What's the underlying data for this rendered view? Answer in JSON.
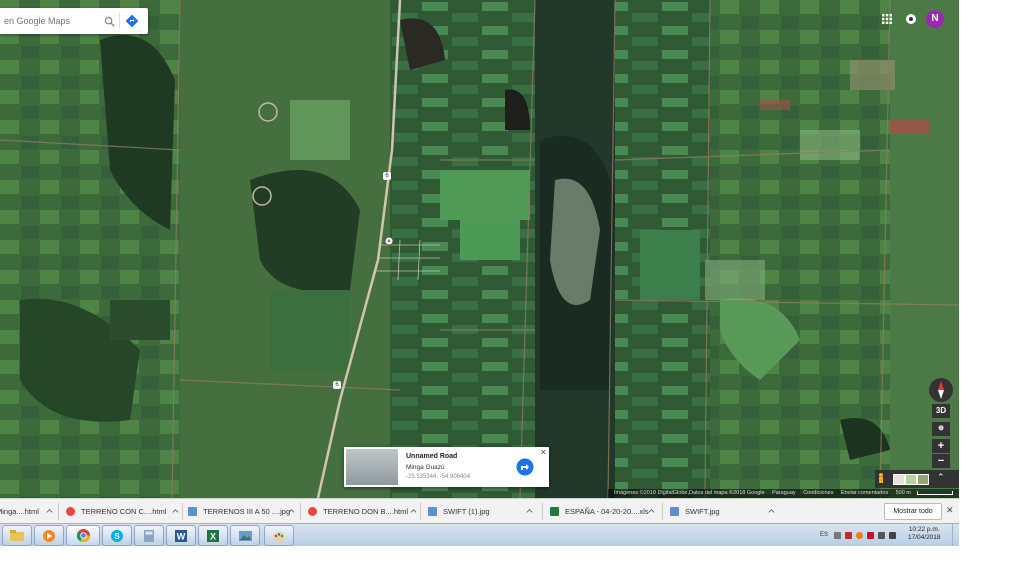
{
  "search": {
    "placeholder": "en Google Maps"
  },
  "icons": {
    "search": "search-icon",
    "directions": "directions-icon",
    "apps": "apps-grid-icon",
    "location": "location-icon",
    "compass": "compass-icon",
    "pegman": "pegman-icon"
  },
  "user": {
    "initial": "N",
    "color": "#9c27b0"
  },
  "map_controls": {
    "three_d": "3D",
    "zoom_in": "+",
    "zoom_out": "−",
    "expand": "⌃"
  },
  "attribution": {
    "imagery": "Imágenes ©2018 DigitalGlobe,Datos del mapa ©2018 Google",
    "country": "Paraguay",
    "terms": "Condiciones",
    "feedback": "Enviar comentarios",
    "scale": "500 m"
  },
  "info_card": {
    "title": "Unnamed Road",
    "subtitle": "Minga Guazú",
    "coords": "-25.535344, -54.906404"
  },
  "route_labels": [
    "6",
    "6"
  ],
  "downloads": {
    "items": [
      {
        "label": "Minga....html",
        "icon_color": "#cccccc"
      },
      {
        "label": "TERRENO CON C....html",
        "icon_color": "#e8453c"
      },
      {
        "label": "TERRENOS III A 50 ....jpg",
        "icon_color": "#5b8ed6"
      },
      {
        "label": "TERRENO DON B....html",
        "icon_color": "#e8453c"
      },
      {
        "label": "SWIFT (1).jpg",
        "icon_color": "#5b8ed6"
      },
      {
        "label": "ESPAÑA - 04-20-20....xls",
        "icon_color": "#1e7b45"
      },
      {
        "label": "SWIFT.jpg",
        "icon_color": "#5b8ed6"
      }
    ],
    "show_all": "Mostrar todo",
    "close": "✕"
  },
  "taskbar": {
    "apps": [
      "explorer",
      "media-player",
      "chrome",
      "skype",
      "calculator",
      "word",
      "excel",
      "pictures",
      "paint"
    ],
    "tray_lang": "ES",
    "time": "10:22 p.m.",
    "date": "17/04/2018"
  }
}
